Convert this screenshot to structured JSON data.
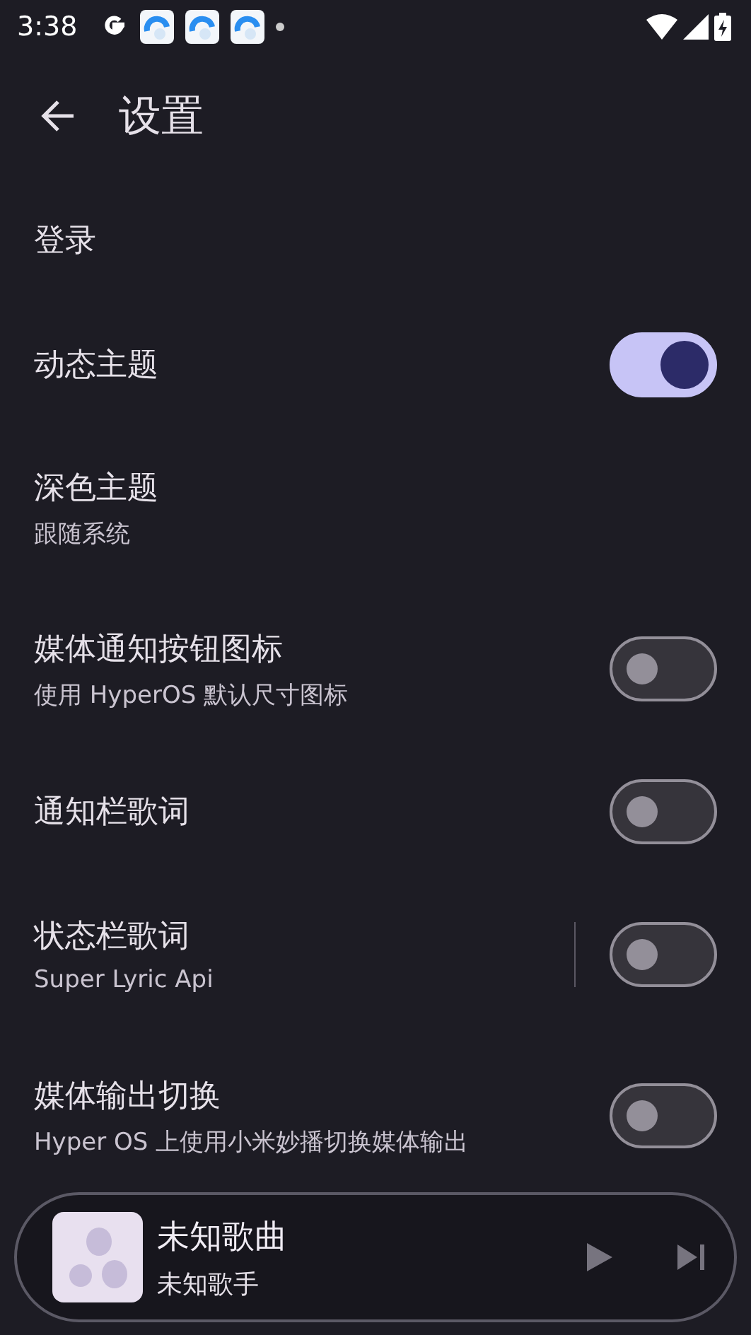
{
  "status_bar": {
    "time": "3:38"
  },
  "app_bar": {
    "title": "设置"
  },
  "settings": [
    {
      "kind": "text",
      "title": "登录"
    },
    {
      "kind": "switch",
      "title": "动态主题",
      "on": true,
      "divider": false
    },
    {
      "kind": "text",
      "title": "深色主题",
      "subtitle": "跟随系统"
    },
    {
      "kind": "switch",
      "title": "媒体通知按钮图标",
      "subtitle": "使用 HyperOS 默认尺寸图标",
      "on": false,
      "divider": false
    },
    {
      "kind": "switch",
      "title": "通知栏歌词",
      "on": false,
      "divider": false
    },
    {
      "kind": "switch",
      "title": "状态栏歌词",
      "subtitle": "Super Lyric Api",
      "on": false,
      "divider": true
    },
    {
      "kind": "switch",
      "title": "媒体输出切换",
      "subtitle": "Hyper OS 上使用小米妙播切换媒体输出",
      "on": false,
      "divider": false
    }
  ],
  "player": {
    "title": "未知歌曲",
    "artist": "未知歌手"
  }
}
